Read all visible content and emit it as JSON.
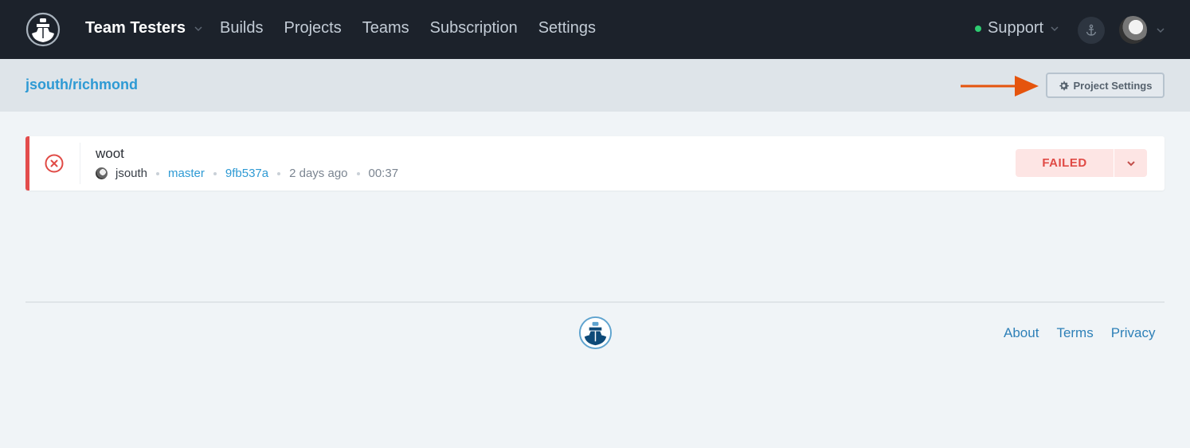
{
  "nav": {
    "team": "Team Testers",
    "links": [
      "Builds",
      "Projects",
      "Teams",
      "Subscription",
      "Settings"
    ],
    "support": "Support",
    "support_status_color": "#2ecc71"
  },
  "subheader": {
    "breadcrumb": "jsouth/richmond",
    "project_settings_label": "Project Settings"
  },
  "build": {
    "title": "woot",
    "author": "jsouth",
    "branch": "master",
    "commit": "9fb537a",
    "time_ago": "2 days ago",
    "duration": "00:37",
    "status": "FAILED",
    "status_color": "#e04a45"
  },
  "footer": {
    "links": [
      "About",
      "Terms",
      "Privacy"
    ]
  }
}
